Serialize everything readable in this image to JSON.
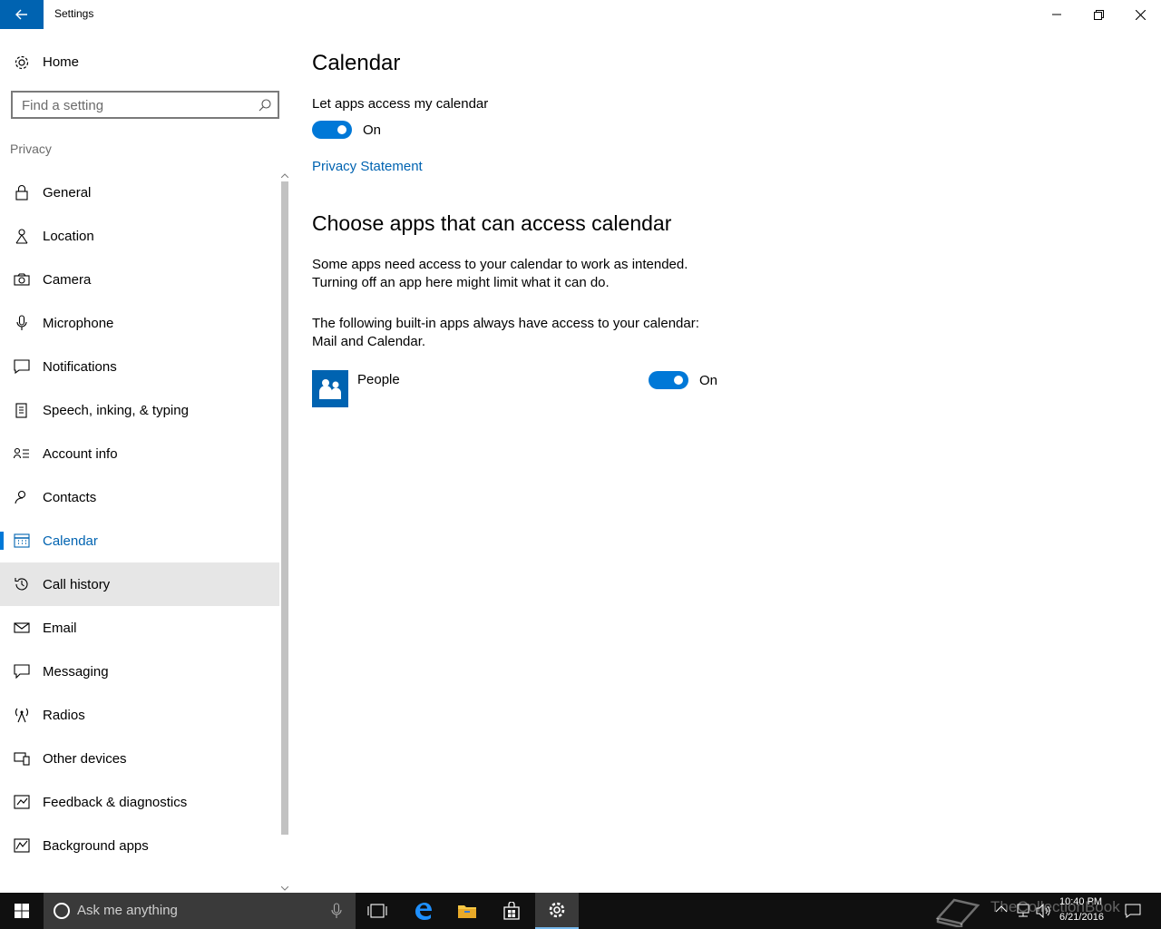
{
  "window": {
    "title": "Settings"
  },
  "sidebar": {
    "home_label": "Home",
    "search_placeholder": "Find a setting",
    "section_label": "Privacy",
    "items": [
      {
        "label": "General",
        "icon": "lock-icon"
      },
      {
        "label": "Location",
        "icon": "location-icon"
      },
      {
        "label": "Camera",
        "icon": "camera-icon"
      },
      {
        "label": "Microphone",
        "icon": "microphone-icon"
      },
      {
        "label": "Notifications",
        "icon": "notifications-icon"
      },
      {
        "label": "Speech, inking, & typing",
        "icon": "speech-icon"
      },
      {
        "label": "Account info",
        "icon": "account-info-icon"
      },
      {
        "label": "Contacts",
        "icon": "contacts-icon"
      },
      {
        "label": "Calendar",
        "icon": "calendar-icon",
        "active": true
      },
      {
        "label": "Call history",
        "icon": "history-icon",
        "hover": true
      },
      {
        "label": "Email",
        "icon": "email-icon"
      },
      {
        "label": "Messaging",
        "icon": "messaging-icon"
      },
      {
        "label": "Radios",
        "icon": "radios-icon"
      },
      {
        "label": "Other devices",
        "icon": "other-devices-icon"
      },
      {
        "label": "Feedback & diagnostics",
        "icon": "feedback-icon"
      },
      {
        "label": "Background apps",
        "icon": "background-apps-icon"
      }
    ]
  },
  "main": {
    "title": "Calendar",
    "let_apps_label": "Let apps access my calendar",
    "toggle_state": "On",
    "privacy_link": "Privacy Statement",
    "choose_title": "Choose apps that can access calendar",
    "desc1_line1": "Some apps need access to your calendar to work as intended.",
    "desc1_line2": "Turning off an app here might limit what it can do.",
    "desc2_line1": "The following built-in apps always have access to your calendar:",
    "desc2_line2": "Mail and Calendar.",
    "apps": [
      {
        "name": "People",
        "state": "On"
      }
    ]
  },
  "taskbar": {
    "search_placeholder": "Ask me anything",
    "time": "10:40 PM",
    "date": "6/21/2016",
    "watermark": "TheCollectionBook"
  },
  "colors": {
    "accent": "#0078d7",
    "accent_dark": "#0063b1",
    "hover": "#e6e6e6",
    "taskbar": "#101010"
  }
}
